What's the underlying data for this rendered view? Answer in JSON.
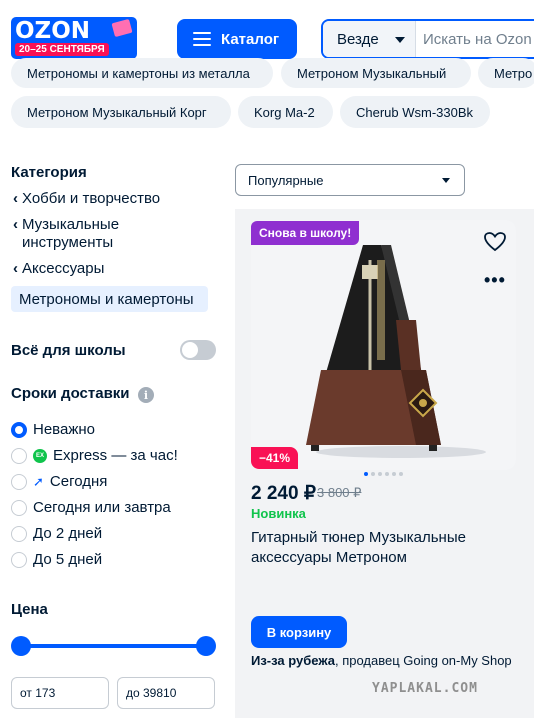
{
  "header": {
    "logo_text": "OZON",
    "logo_dates": "20–25 СЕНТЯБРЯ",
    "catalog_label": "Каталог",
    "search_scope": "Везде",
    "search_placeholder": "Искать на Ozon",
    "brand_color": "#005bff"
  },
  "chips": [
    "Метрономы и камертоны из металла",
    "Метроном Музыкальный",
    "Метро",
    "Метроном Музыкальный Корг",
    "Korg Ma-2",
    "Cherub Wsm-330Bk"
  ],
  "sidebar": {
    "category_title": "Категория",
    "breadcrumbs": [
      "Хобби и творчество",
      "Музыкальные инструменты",
      "Аксессуары"
    ],
    "active_category": "Метрономы и камертоны",
    "school_label": "Всё для школы",
    "school_toggle": false,
    "delivery_title": "Сроки доставки",
    "delivery_options": [
      {
        "label": "Неважно",
        "selected": true,
        "icon": ""
      },
      {
        "label": "Express — за час!",
        "selected": false,
        "icon": "express-icon"
      },
      {
        "label": "Сегодня",
        "selected": false,
        "icon": "rocket-icon"
      },
      {
        "label": "Сегодня или завтра",
        "selected": false,
        "icon": ""
      },
      {
        "label": "До 2 дней",
        "selected": false,
        "icon": ""
      },
      {
        "label": "До 5 дней",
        "selected": false,
        "icon": ""
      }
    ],
    "price_title": "Цена",
    "price_from": "от 173",
    "price_to": "до 39810"
  },
  "sort": {
    "selected": "Популярные"
  },
  "product": {
    "badge": "Снова в школу!",
    "discount": "−41%",
    "price": "2 240 ₽",
    "old_price": "3 800 ₽",
    "novelty": "Новинка",
    "title": "Гитарный тюнер Музыкальные аксессуары Метроном",
    "cart_label": "В корзину",
    "seller_bold": "Из-за рубежа",
    "seller_rest": ", продавец Going on-My Shop",
    "gallery_count": 6,
    "gallery_index": 0
  },
  "watermark": "YAPLAKAL.COM"
}
